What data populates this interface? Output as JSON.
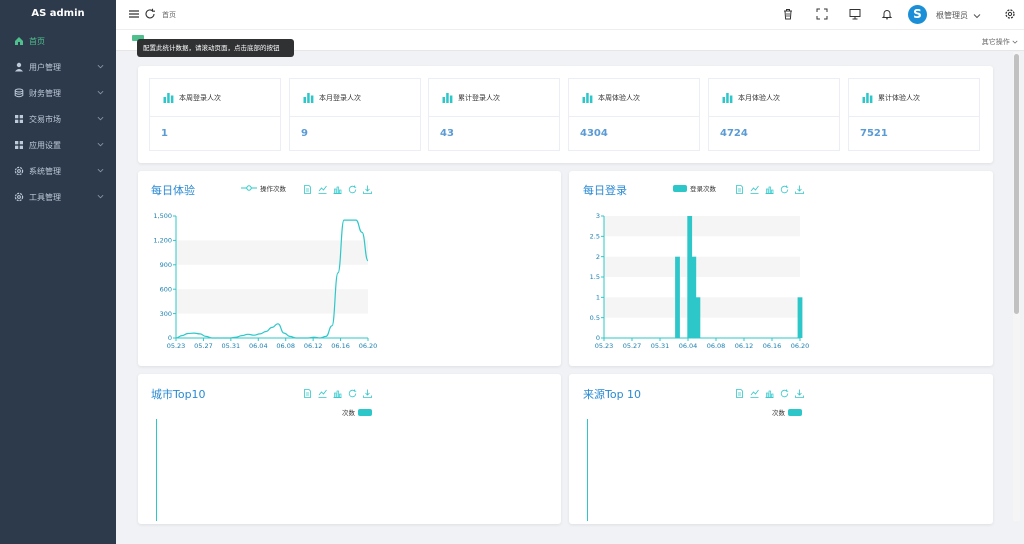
{
  "app": {
    "title": "AS admin"
  },
  "sidebar": {
    "items": [
      {
        "label": "首页",
        "icon": "home-icon",
        "active": true
      },
      {
        "label": "用户管理",
        "icon": "user-icon"
      },
      {
        "label": "财务管理",
        "icon": "database-icon"
      },
      {
        "label": "交易市场",
        "icon": "grid-icon"
      },
      {
        "label": "应用设置",
        "icon": "grid-icon"
      },
      {
        "label": "系统管理",
        "icon": "gear-icon"
      },
      {
        "label": "工具管理",
        "icon": "gear-icon"
      }
    ]
  },
  "header": {
    "breadcrumb": "首页",
    "avatar_letter": "S",
    "username": "根管理员"
  },
  "tagsbar": {
    "tooltip": "配置此统计数据，请滚动页面，点击底部的按钮",
    "other_ops": "其它操作"
  },
  "stats": [
    {
      "label": "本周登录人次",
      "value": "1"
    },
    {
      "label": "本月登录人次",
      "value": "9"
    },
    {
      "label": "累计登录人次",
      "value": "43"
    },
    {
      "label": "本周体验人次",
      "value": "4304"
    },
    {
      "label": "本月体验人次",
      "value": "4724"
    },
    {
      "label": "累计体验人次",
      "value": "7521"
    }
  ],
  "panels": {
    "daily_experience": {
      "title": "每日体验"
    },
    "daily_login": {
      "title": "每日登录"
    },
    "city_top": {
      "title": "城市Top10"
    },
    "source_top": {
      "title": "来源Top 10"
    }
  },
  "chart_data": [
    {
      "type": "line",
      "title": "每日体验",
      "series": [
        {
          "name": "操作次数",
          "values": [
            0,
            30,
            55,
            60,
            50,
            20,
            0,
            0,
            0,
            0,
            10,
            30,
            45,
            35,
            50,
            80,
            130,
            175,
            60,
            20,
            0,
            0,
            0,
            10,
            0,
            20,
            150,
            800,
            1450,
            1450,
            1450,
            1300,
            950
          ]
        }
      ],
      "x_ticks": [
        "05.23",
        "05.27",
        "05.31",
        "06.04",
        "06.08",
        "06.12",
        "06.16",
        "06.20"
      ],
      "y_ticks": [
        "0",
        "300",
        "600",
        "900",
        "1,200",
        "1,500"
      ],
      "ylim": [
        0,
        1500
      ],
      "color": "#2ec7c9"
    },
    {
      "type": "bar",
      "title": "每日登录",
      "series": [
        {
          "name": "登录次数",
          "values": [
            0,
            0,
            0,
            0,
            0,
            0,
            0,
            0,
            0,
            0,
            0,
            0,
            0,
            0,
            0,
            0,
            0,
            0,
            2,
            0,
            0,
            3,
            2,
            1,
            0,
            0,
            0,
            0,
            0,
            0,
            0,
            0,
            0,
            0,
            0,
            0,
            0,
            0,
            0,
            0,
            0,
            0,
            0,
            0,
            0,
            0,
            0,
            0,
            1
          ]
        }
      ],
      "x_ticks": [
        "05.23",
        "05.27",
        "05.31",
        "06.04",
        "06.08",
        "06.12",
        "06.16",
        "06.20"
      ],
      "y_ticks": [
        "0",
        "0.5",
        "1",
        "1.5",
        "2",
        "2.5",
        "3"
      ],
      "ylim": [
        0,
        3
      ],
      "color": "#2ec7c9"
    },
    {
      "type": "bar",
      "title": "城市Top10",
      "series": [
        {
          "name": "次数",
          "values": []
        }
      ],
      "color": "#2ec7c9"
    },
    {
      "type": "bar",
      "title": "来源Top 10",
      "series": [
        {
          "name": "次数",
          "values": []
        }
      ],
      "color": "#2ec7c9"
    }
  ]
}
